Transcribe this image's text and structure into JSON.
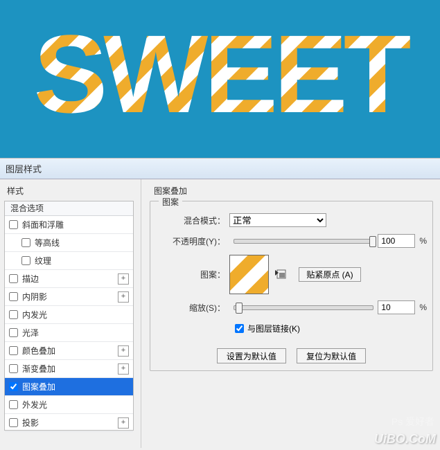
{
  "canvas_text": "SWEET",
  "dialog_title": "图层样式",
  "left": {
    "section": "样式",
    "header": "混合选项",
    "items": [
      {
        "label": "斜面和浮雕",
        "checked": false,
        "plus": false,
        "sub": false
      },
      {
        "label": "等高线",
        "checked": false,
        "plus": false,
        "sub": true
      },
      {
        "label": "纹理",
        "checked": false,
        "plus": false,
        "sub": true
      },
      {
        "label": "描边",
        "checked": false,
        "plus": true,
        "sub": false
      },
      {
        "label": "内阴影",
        "checked": false,
        "plus": true,
        "sub": false
      },
      {
        "label": "内发光",
        "checked": false,
        "plus": false,
        "sub": false
      },
      {
        "label": "光泽",
        "checked": false,
        "plus": false,
        "sub": false
      },
      {
        "label": "颜色叠加",
        "checked": false,
        "plus": true,
        "sub": false
      },
      {
        "label": "渐变叠加",
        "checked": false,
        "plus": true,
        "sub": false
      },
      {
        "label": "图案叠加",
        "checked": true,
        "plus": false,
        "sub": false,
        "selected": true
      },
      {
        "label": "外发光",
        "checked": false,
        "plus": false,
        "sub": false
      },
      {
        "label": "投影",
        "checked": false,
        "plus": true,
        "sub": false
      }
    ]
  },
  "right": {
    "group_title": "图案叠加",
    "legend": "图案",
    "blend_label": "混合模式：",
    "blend_value": "正常",
    "opacity_label": "不透明度(Y)：",
    "opacity_value": "100",
    "opacity_unit": "%",
    "pattern_label": "图案：",
    "snap_label": "贴紧原点 (A)",
    "scale_label": "缩放(S)：",
    "scale_value": "10",
    "scale_unit": "%",
    "link_label": "与图层链接(K)",
    "btn_default": "设置为默认值",
    "btn_reset": "复位为默认值"
  },
  "watermark_domain": "UiBO.CoM",
  "watermark_brand": "Ps 爱好者"
}
